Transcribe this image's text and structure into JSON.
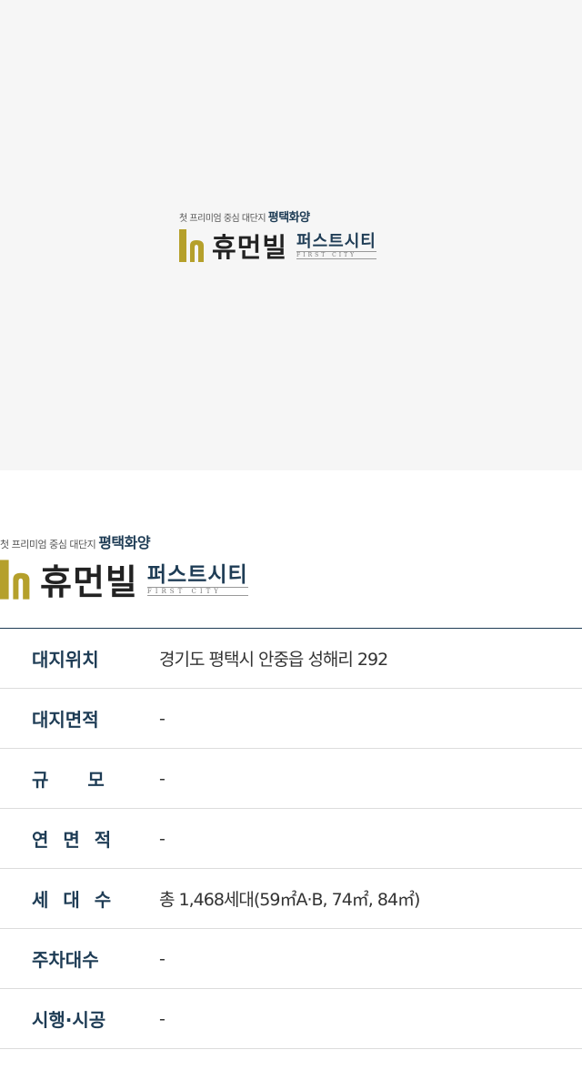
{
  "logo": {
    "tagline": "첫 프리미엄 중심 대단지",
    "region": "평택화양",
    "brand": "휴먼빌",
    "sub_ko": "퍼스트시티",
    "sub_en": "FIRST CITY",
    "accent_color": "#b5a02b",
    "navy_color": "#1e3c55"
  },
  "info": [
    {
      "label": "대지위치",
      "value": "경기도 평택시 안중읍 성해리 292"
    },
    {
      "label": "대지면적",
      "value": "-"
    },
    {
      "label": "규모",
      "value": "-"
    },
    {
      "label": "연면적",
      "value": "-"
    },
    {
      "label": "세대수",
      "value": "총 1,468세대(59㎡A·B, 74㎡, 84㎡)"
    },
    {
      "label": "주차대수",
      "value": "-"
    },
    {
      "label": "시행·시공",
      "value": "-"
    }
  ]
}
